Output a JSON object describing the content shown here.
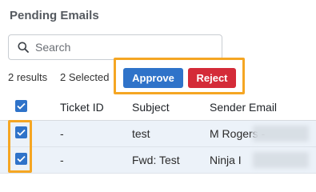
{
  "page": {
    "title": "Pending Emails"
  },
  "search": {
    "placeholder": "Search",
    "value": ""
  },
  "summary": {
    "results": "2 results",
    "selected": "2 Selected"
  },
  "actions": {
    "approve_label": "Approve",
    "reject_label": "Reject"
  },
  "table": {
    "columns": [
      "Ticket ID",
      "Subject",
      "Sender Email"
    ],
    "rows": [
      {
        "ticket_id": "-",
        "subject": "test",
        "sender": "M Rogers -",
        "selected": true
      },
      {
        "ticket_id": "-",
        "subject": "Fwd: Test",
        "sender": "Ninja I",
        "selected": true
      }
    ]
  },
  "colors": {
    "accent": "#2f73c9",
    "danger": "#d42b38",
    "highlight": "#f5a623",
    "selected_row": "#ecf2f9"
  }
}
